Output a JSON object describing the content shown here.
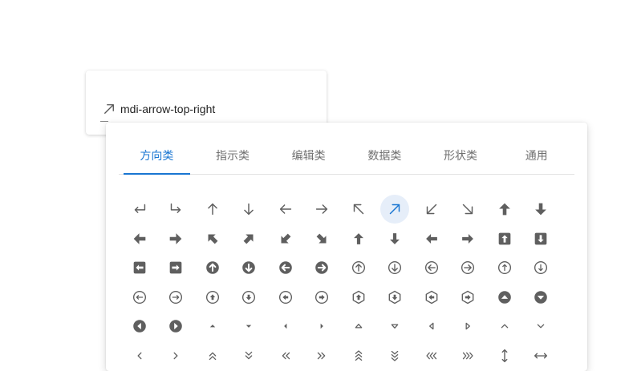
{
  "field": {
    "value": "mdi-arrow-top-right",
    "icon": "arrow-top-right-icon"
  },
  "tabs": [
    {
      "label": "方向类",
      "active": true
    },
    {
      "label": "指示类",
      "active": false
    },
    {
      "label": "编辑类",
      "active": false
    },
    {
      "label": "数据类",
      "active": false
    },
    {
      "label": "形状类",
      "active": false
    },
    {
      "label": "通用",
      "active": false
    }
  ],
  "colors": {
    "accent": "#1976d2",
    "icon": "#5f5f5f",
    "selected_bg": "#e6eef9"
  },
  "selected_icon": "arrow-top-right-icon",
  "icons": [
    "arrow-left-bottom-icon",
    "arrow-right-bottom-icon",
    "arrow-up-icon",
    "arrow-down-icon",
    "arrow-left-icon",
    "arrow-right-icon",
    "arrow-top-left-icon",
    "arrow-top-right-icon",
    "arrow-bottom-left-icon",
    "arrow-bottom-right-icon",
    "arrow-up-bold-icon",
    "arrow-down-bold-icon",
    "arrow-left-bold-icon",
    "arrow-right-bold-icon",
    "arrow-top-left-bold-icon",
    "arrow-top-right-bold-icon",
    "arrow-bottom-left-bold-icon",
    "arrow-bottom-right-bold-icon",
    "arrow-up-thick-icon",
    "arrow-down-thick-icon",
    "arrow-left-thick-icon",
    "arrow-right-thick-icon",
    "arrow-up-box-icon",
    "arrow-down-box-icon",
    "arrow-left-box-icon",
    "arrow-right-box-icon",
    "arrow-up-circle-icon",
    "arrow-down-circle-icon",
    "arrow-left-circle-icon",
    "arrow-right-circle-icon",
    "arrow-up-circle-outline-icon",
    "arrow-down-circle-outline-icon",
    "arrow-left-circle-outline-icon",
    "arrow-right-circle-outline-icon",
    "arrow-up-thin-circle-outline-icon",
    "arrow-down-thin-circle-outline-icon",
    "arrow-left-thin-circle-outline-icon",
    "arrow-right-thin-circle-outline-icon",
    "arrow-up-drop-circle-outline-icon",
    "arrow-down-drop-circle-outline-icon",
    "arrow-left-drop-circle-outline-icon",
    "arrow-right-drop-circle-outline-icon",
    "arrow-up-bold-hexagon-outline-icon",
    "arrow-down-bold-hexagon-outline-icon",
    "arrow-left-bold-hexagon-outline-icon",
    "arrow-right-bold-hexagon-outline-icon",
    "arrow-up-drop-circle-icon",
    "arrow-down-drop-circle-icon",
    "arrow-left-drop-circle-icon",
    "arrow-right-drop-circle-icon",
    "menu-up-icon",
    "menu-down-icon",
    "menu-left-icon",
    "menu-right-icon",
    "menu-up-outline-icon",
    "menu-down-outline-icon",
    "menu-left-outline-icon",
    "menu-right-outline-icon",
    "chevron-up-icon",
    "chevron-down-icon",
    "chevron-left-icon",
    "chevron-right-icon",
    "chevron-double-up-icon",
    "chevron-double-down-icon",
    "chevron-double-left-icon",
    "chevron-double-right-icon",
    "chevron-triple-up-icon",
    "chevron-triple-down-icon",
    "chevron-triple-left-icon",
    "chevron-triple-right-icon",
    "arrow-up-down-icon",
    "arrow-left-right-icon"
  ]
}
